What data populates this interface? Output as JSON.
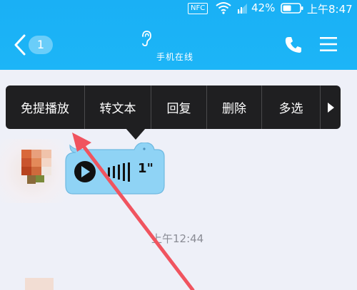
{
  "status_bar": {
    "nfc": "NFC",
    "battery_percent": "42%",
    "time": "上午8:47"
  },
  "header": {
    "unread_count": "1",
    "subtitle": "手机在线"
  },
  "context_menu": {
    "items": [
      "免提播放",
      "转文本",
      "回复",
      "删除",
      "多选"
    ]
  },
  "message": {
    "duration": "1\""
  },
  "timestamp": "上午12:44",
  "colors": {
    "header": "#1ab0f5",
    "menu_bg": "#1f1f21",
    "bubble": "#8fd3f5",
    "annotation_arrow": "#f0545f"
  }
}
